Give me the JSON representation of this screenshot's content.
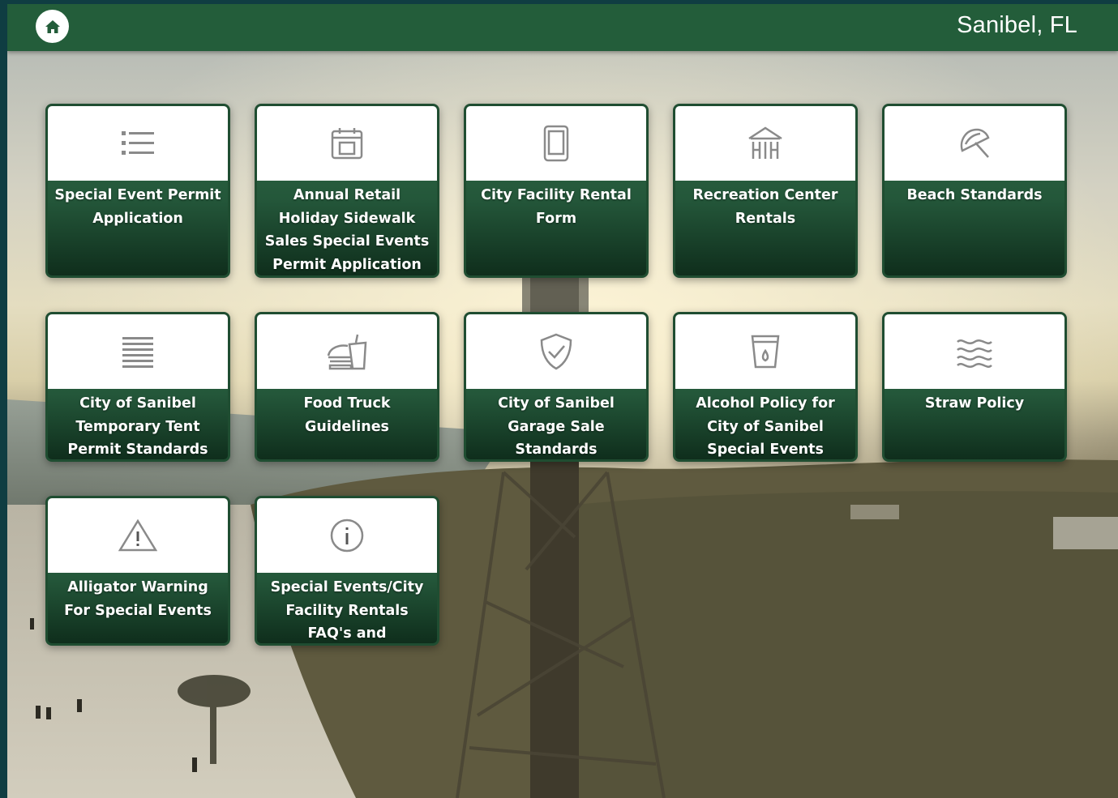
{
  "header": {
    "home_icon": "home-icon",
    "title": "Sanibel, FL"
  },
  "tiles": [
    {
      "label": "Special Event Permit Application",
      "icon": "list-icon"
    },
    {
      "label": "Annual Retail Holiday Sidewalk Sales Special Events Permit Application",
      "icon": "calendar-icon"
    },
    {
      "label": "City Facility Rental Form",
      "icon": "tablet-icon"
    },
    {
      "label": "Recreation Center Rentals",
      "icon": "building-icon"
    },
    {
      "label": "Beach Standards",
      "icon": "beach-umbrella-icon"
    },
    {
      "label": "City of Sanibel Temporary Tent Permit Standards",
      "icon": "lines-icon"
    },
    {
      "label": "Food Truck Guidelines",
      "icon": "food-icon"
    },
    {
      "label": "City of Sanibel Garage Sale Standards",
      "icon": "shield-check-icon"
    },
    {
      "label": "Alcohol Policy for City of Sanibel Special Events",
      "icon": "cup-icon"
    },
    {
      "label": "Straw Policy",
      "icon": "waves-icon"
    },
    {
      "label": "Alligator Warning For Special Events",
      "icon": "warning-icon"
    },
    {
      "label": "Special Events/City Facility Rentals FAQ's and Information",
      "icon": "info-icon"
    }
  ],
  "colors": {
    "header_bg": "#235d3a",
    "tile_green": "#24573a",
    "icon_gray": "#8a8a8a"
  }
}
